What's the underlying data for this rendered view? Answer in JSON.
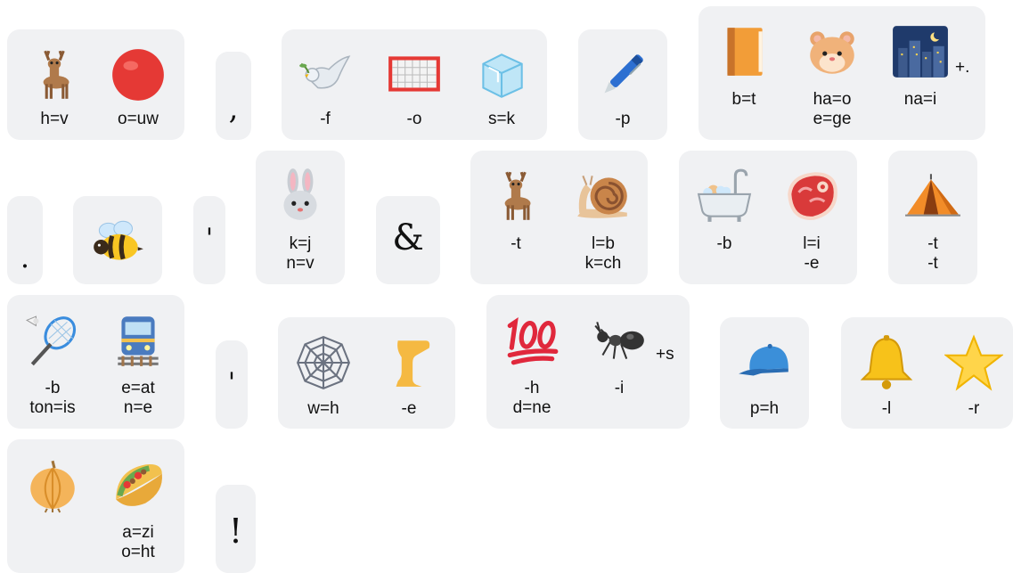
{
  "rows": [
    {
      "tiles": [
        {
          "items": [
            {
              "icon": "deer-icon",
              "labels": [
                "h=v"
              ]
            },
            {
              "icon": "red-circle-icon",
              "labels": [
                "o=uw"
              ]
            }
          ]
        },
        {
          "punct": ","
        },
        {
          "items": [
            {
              "icon": "dove-icon",
              "labels": [
                "-f"
              ]
            },
            {
              "icon": "goal-net-icon",
              "labels": [
                "-o"
              ]
            },
            {
              "icon": "ice-cube-icon",
              "labels": [
                "s=k"
              ]
            }
          ]
        },
        {
          "items": [
            {
              "icon": "pen-icon",
              "labels": [
                "-p"
              ]
            }
          ]
        },
        {
          "items": [
            {
              "icon": "book-icon",
              "labels": [
                "b=t"
              ]
            },
            {
              "icon": "hamster-icon",
              "labels": [
                "ha=o",
                "e=ge"
              ]
            },
            {
              "icon": "night-city-icon",
              "labels": [
                "na=i"
              ],
              "suffix": "+."
            }
          ]
        }
      ]
    },
    {
      "tiles": [
        {
          "punct": "."
        },
        {
          "items": [
            {
              "icon": "bee-icon",
              "labels": []
            }
          ]
        },
        {
          "punct": "'"
        },
        {
          "items": [
            {
              "icon": "rabbit-icon",
              "labels": [
                "k=j",
                "n=v"
              ]
            }
          ]
        },
        {
          "punct": "&"
        },
        {
          "items": [
            {
              "icon": "deer-icon",
              "labels": [
                "-t"
              ]
            },
            {
              "icon": "snail-icon",
              "labels": [
                "l=b",
                "k=ch"
              ]
            }
          ]
        },
        {
          "items": [
            {
              "icon": "bathtub-icon",
              "labels": [
                "-b"
              ]
            },
            {
              "icon": "meat-icon",
              "labels": [
                "l=i",
                "-e"
              ]
            }
          ]
        },
        {
          "items": [
            {
              "icon": "tent-icon",
              "labels": [
                "-t",
                "-t"
              ]
            }
          ]
        }
      ]
    },
    {
      "tiles": [
        {
          "items": [
            {
              "icon": "badminton-icon",
              "labels": [
                "-b",
                "ton=is"
              ]
            },
            {
              "icon": "train-icon",
              "labels": [
                "e=at",
                "n=e"
              ]
            }
          ]
        },
        {
          "punct": "'"
        },
        {
          "items": [
            {
              "icon": "spider-web-icon",
              "labels": [
                "w=h"
              ]
            },
            {
              "icon": "leg-icon",
              "labels": [
                "-e"
              ]
            }
          ]
        },
        {
          "items": [
            {
              "icon": "hundred-icon",
              "labels": [
                "-h",
                "d=ne"
              ]
            },
            {
              "icon": "ant-icon",
              "labels": [
                "-i"
              ],
              "suffix": "+s"
            }
          ]
        },
        {
          "items": [
            {
              "icon": "cap-icon",
              "labels": [
                "p=h"
              ]
            }
          ]
        },
        {
          "items": [
            {
              "icon": "bell-icon",
              "labels": [
                "-l"
              ]
            },
            {
              "icon": "star-icon",
              "labels": [
                "-r"
              ]
            }
          ]
        }
      ]
    },
    {
      "tiles": [
        {
          "items": [
            {
              "icon": "onion-icon",
              "labels": []
            },
            {
              "icon": "taco-icon",
              "labels": [
                "a=zi",
                "o=ht"
              ]
            }
          ]
        },
        {
          "punct": "!"
        }
      ]
    }
  ]
}
